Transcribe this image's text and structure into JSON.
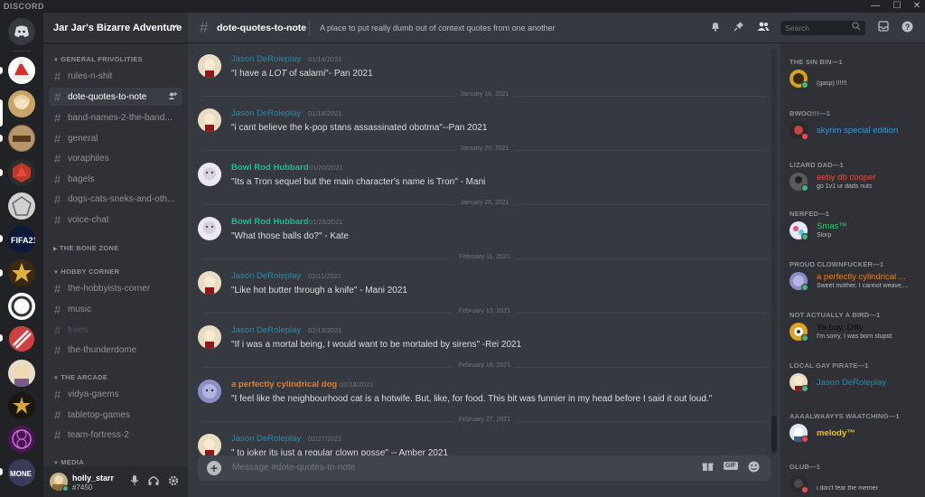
{
  "app": {
    "brand": "DISCORD"
  },
  "window": {
    "minimize": "—",
    "maximize": "☐",
    "close": "✕"
  },
  "guild": {
    "name": "Jar Jar's Bizarre Adventure"
  },
  "categories": {
    "general": "GENERAL FRIVOLITIES",
    "bone": "THE BONE ZONE",
    "hobby": "HOBBY CORNER",
    "arcade": "THE ARCADE",
    "media": "MEDIA"
  },
  "channels": [
    {
      "name": "rules-n-shit"
    },
    {
      "name": "dote-quotes-to-note"
    },
    {
      "name": "band-names-2-the-band..."
    },
    {
      "name": "general"
    },
    {
      "name": "voraphiles"
    },
    {
      "name": "bagels"
    },
    {
      "name": "dogs-cats-sneks-and-oth..."
    },
    {
      "name": "voice-chat"
    },
    {
      "name": "the-hobbyists-corner"
    },
    {
      "name": "music"
    },
    {
      "name": "trees"
    },
    {
      "name": "the-thunderdome"
    },
    {
      "name": "vidya-gaems"
    },
    {
      "name": "tabletop-games"
    },
    {
      "name": "team-fortress-2"
    }
  ],
  "user": {
    "name": "holly_starr",
    "discriminator": "#7450"
  },
  "channel_header": {
    "name": "dote-quotes-to-note",
    "topic": "A place to put really dumb out of context quotes from one another",
    "search_placeholder": "Search"
  },
  "messages": [
    {
      "author": "Jason DeRoleplay",
      "time": "01/14/2021",
      "text_before": "\"I have a ",
      "text_em": "LOT",
      "text_after": " of salami\"- Pan 2021",
      "color": "#1a8fb8"
    },
    {
      "divider": "January 18, 2021"
    },
    {
      "author": "Jason DeRoleplay",
      "time": "01/18/2021",
      "text": "\"i cant believe the k-pop stans assassinated obotma\"--Pan 2021",
      "color": "#1a8fb8"
    },
    {
      "divider": "January 20, 2021"
    },
    {
      "author": "Bowl Rod Hubbard",
      "time": "01/20/2021",
      "text": "\"Its a Tron sequel but the main character's name is Tron\" - Mani",
      "color": "#1abc9c"
    },
    {
      "divider": "January 25, 2021"
    },
    {
      "author": "Bowl Rod Hubbard",
      "time": "01/25/2021",
      "text": "\"What those balls do?\" - Kate",
      "color": "#1abc9c"
    },
    {
      "divider": "February 11, 2021"
    },
    {
      "author": "Jason DeRoleplay",
      "time": "02/11/2021",
      "text": "\"Like hot butter through a knife\" - Mani 2021",
      "color": "#1a8fb8"
    },
    {
      "divider": "February 13, 2021"
    },
    {
      "author": "Jason DeRoleplay",
      "time": "02/13/2021",
      "text": "\"If i was a mortal being, I would want to be mortaled by sirens\" -Rei 2021",
      "color": "#1a8fb8"
    },
    {
      "divider": "February 18, 2021"
    },
    {
      "author": "a perfectly cylindrical dog",
      "time": "02/18/2021",
      "text": "\"I feel like the neighbourhood cat is a hotwife. But, like, for food. This bit was funnier in my head before I said it out loud.\"",
      "color": "#e67e22"
    },
    {
      "divider": "February 27, 2021"
    },
    {
      "author": "Jason DeRoleplay",
      "time": "02/27/2021",
      "text": "\" to joker its just a regular clown posse\" -- Amber 2021",
      "color": "#1a8fb8"
    }
  ],
  "composer": {
    "placeholder": "Message #dote-quotes-to-note",
    "gif_label": "GIF"
  },
  "members": [
    {
      "role": "THE SIN BIN—1",
      "name": "",
      "status": "(gasp) !!!!!!",
      "color": "#8b3a2a",
      "dot": "#43b581"
    },
    {
      "role": "BWOO!!!—1",
      "name": "skyrim special edition",
      "status": "",
      "color": "#3498db",
      "dot": "#f04747"
    },
    {
      "role": "LIZARD DAD—1",
      "name": "eeby db cooper",
      "status": "go 1v1 ur dads nuts",
      "color": "#e74c3c",
      "dot": "#43b581"
    },
    {
      "role": "NERFED—1",
      "name": "Smas™",
      "status": "Slorp",
      "color": "#2ecc71",
      "dot": "#43b581"
    },
    {
      "role": "PROUD CLOWNFUCKER—1",
      "name": "a perfectly cylindrical ...",
      "status": "Sweet mother, I cannot weave,...",
      "color": "#e67e22",
      "dot": "#43b581"
    },
    {
      "role": "NOT ACTUALLY A BIRD—1",
      "name": "Ya boy, Dilly",
      "status": "I'm sorry, I was born stupid.",
      "color": "#0a0a0a",
      "dot": "#43b581"
    },
    {
      "role": "LOCAL GAY PIRATE—1",
      "name": "Jason DeRoleplay",
      "status": "",
      "color": "#1a8fb8",
      "dot": "#43b581"
    },
    {
      "role": "AAAALWAAYYS WAATCHING—1",
      "name": "melody™",
      "status": "",
      "color": "#f1c40f",
      "dot": "#f04747"
    },
    {
      "role": "GLUB—1",
      "name": "",
      "status": "i don't fear the memer",
      "color": "#9b1f6a",
      "dot": "#f04747"
    }
  ],
  "colors": {
    "accent_blurple": "#7289da",
    "online": "#43b581",
    "dnd": "#f04747"
  }
}
